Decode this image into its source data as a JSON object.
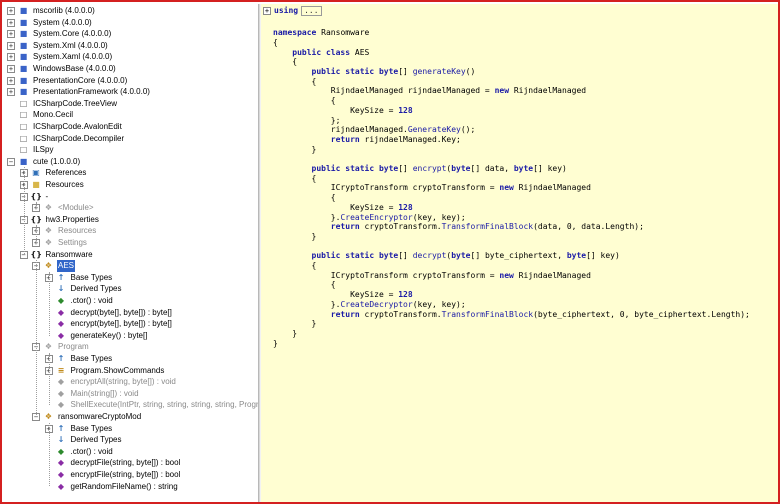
{
  "tree": [
    {
      "depth": 0,
      "exp": "+",
      "icon": "assembly-icon",
      "label": "mscorlib (4.0.0.0)"
    },
    {
      "depth": 0,
      "exp": "+",
      "icon": "assembly-icon",
      "label": "System (4.0.0.0)"
    },
    {
      "depth": 0,
      "exp": "+",
      "icon": "assembly-icon",
      "label": "System.Core (4.0.0.0)"
    },
    {
      "depth": 0,
      "exp": "+",
      "icon": "assembly-icon",
      "label": "System.Xml (4.0.0.0)"
    },
    {
      "depth": 0,
      "exp": "+",
      "icon": "assembly-icon",
      "label": "System.Xaml (4.0.0.0)"
    },
    {
      "depth": 0,
      "exp": "+",
      "icon": "assembly-icon",
      "label": "WindowsBase (4.0.0.0)"
    },
    {
      "depth": 0,
      "exp": "+",
      "icon": "assembly-icon",
      "label": "PresentationCore (4.0.0.0)"
    },
    {
      "depth": 0,
      "exp": "+",
      "icon": "assembly-icon",
      "label": "PresentationFramework (4.0.0.0)"
    },
    {
      "depth": 0,
      "exp": "",
      "icon": "file-icon",
      "label": "ICSharpCode.TreeView"
    },
    {
      "depth": 0,
      "exp": "",
      "icon": "file-icon",
      "label": "Mono.Cecil"
    },
    {
      "depth": 0,
      "exp": "",
      "icon": "file-icon",
      "label": "ICSharpCode.AvalonEdit"
    },
    {
      "depth": 0,
      "exp": "",
      "icon": "file-icon",
      "label": "ICSharpCode.Decompiler"
    },
    {
      "depth": 0,
      "exp": "",
      "icon": "file-icon",
      "label": "ILSpy"
    },
    {
      "depth": 0,
      "exp": "-",
      "icon": "assembly-icon",
      "label": "cute (1.0.0.0)"
    },
    {
      "depth": 1,
      "exp": "+",
      "icon": "references-icon",
      "label": "References"
    },
    {
      "depth": 1,
      "exp": "+",
      "icon": "resources-folder-icon",
      "label": "Resources"
    },
    {
      "depth": 1,
      "exp": "-",
      "icon": "namespace-icon",
      "label": "-"
    },
    {
      "depth": 2,
      "exp": "+",
      "icon": "class-icon",
      "label": "<Module>",
      "dim": true
    },
    {
      "depth": 1,
      "exp": "-",
      "icon": "namespace-icon",
      "label": "hw3.Properties"
    },
    {
      "depth": 2,
      "exp": "+",
      "icon": "class-icon",
      "label": "Resources",
      "dim": true
    },
    {
      "depth": 2,
      "exp": "+",
      "icon": "class-icon",
      "label": "Settings",
      "dim": true
    },
    {
      "depth": 1,
      "exp": "-",
      "icon": "namespace-icon",
      "label": "Ransomware"
    },
    {
      "depth": 2,
      "exp": "-",
      "icon": "class-icon",
      "label": "AES",
      "selected": true
    },
    {
      "depth": 3,
      "exp": "+",
      "icon": "base-types-icon",
      "label": "Base Types"
    },
    {
      "depth": 3,
      "exp": "",
      "icon": "derived-types-icon",
      "label": "Derived Types"
    },
    {
      "depth": 3,
      "exp": "",
      "icon": "constructor-icon",
      "label": ".ctor() : void"
    },
    {
      "depth": 3,
      "exp": "",
      "icon": "method-icon",
      "label": "decrypt(byte[], byte[]) : byte[]"
    },
    {
      "depth": 3,
      "exp": "",
      "icon": "method-icon",
      "label": "encrypt(byte[], byte[]) : byte[]"
    },
    {
      "depth": 3,
      "exp": "",
      "icon": "method-icon",
      "label": "generateKey() : byte[]"
    },
    {
      "depth": 2,
      "exp": "-",
      "icon": "class-icon",
      "label": "Program",
      "dim": true
    },
    {
      "depth": 3,
      "exp": "+",
      "icon": "base-types-icon",
      "label": "Base Types"
    },
    {
      "depth": 3,
      "exp": "+",
      "icon": "enum-icon",
      "label": "Program.ShowCommands"
    },
    {
      "depth": 3,
      "exp": "",
      "icon": "method-icon",
      "label": "encryptAll(string, byte[]) : void",
      "dim": true
    },
    {
      "depth": 3,
      "exp": "",
      "icon": "method-icon",
      "label": "Main(string[]) : void",
      "dim": true
    },
    {
      "depth": 3,
      "exp": "",
      "icon": "method-icon",
      "label": "ShellExecute(IntPtr, string, string, string, string, Progra",
      "dim": true
    },
    {
      "depth": 2,
      "exp": "-",
      "icon": "class-icon",
      "label": "ransomwareCryptoMod"
    },
    {
      "depth": 3,
      "exp": "+",
      "icon": "base-types-icon",
      "label": "Base Types"
    },
    {
      "depth": 3,
      "exp": "",
      "icon": "derived-types-icon",
      "label": "Derived Types"
    },
    {
      "depth": 3,
      "exp": "",
      "icon": "constructor-icon",
      "label": ".ctor() : void"
    },
    {
      "depth": 3,
      "exp": "",
      "icon": "method-icon",
      "label": "decryptFile(string, byte[]) : bool"
    },
    {
      "depth": 3,
      "exp": "",
      "icon": "method-icon",
      "label": "encryptFile(string, byte[]) : bool"
    },
    {
      "depth": 3,
      "exp": "",
      "icon": "method-icon",
      "label": "getRandomFileName() : string"
    }
  ],
  "code": {
    "using_keyword": "using",
    "using_collapsed": "...",
    "lines": [
      [],
      [
        [
          "kw",
          "namespace"
        ],
        [
          "t",
          " Ransomware"
        ]
      ],
      [
        [
          "t",
          "{"
        ]
      ],
      [
        [
          "t",
          "    "
        ],
        [
          "kw",
          "public class"
        ],
        [
          "t",
          " AES"
        ]
      ],
      [
        [
          "t",
          "    {"
        ]
      ],
      [
        [
          "t",
          "        "
        ],
        [
          "kw",
          "public static byte"
        ],
        [
          "t",
          "[] "
        ],
        [
          "fn",
          "generateKey"
        ],
        [
          "t",
          "()"
        ]
      ],
      [
        [
          "t",
          "        {"
        ]
      ],
      [
        [
          "t",
          "            RijndaelManaged rijndaelManaged = "
        ],
        [
          "kw",
          "new"
        ],
        [
          "t",
          " RijndaelManaged"
        ]
      ],
      [
        [
          "t",
          "            {"
        ]
      ],
      [
        [
          "t",
          "                KeySize = "
        ],
        [
          "num",
          "128"
        ]
      ],
      [
        [
          "t",
          "            };"
        ]
      ],
      [
        [
          "t",
          "            rijndaelManaged."
        ],
        [
          "fn",
          "GenerateKey"
        ],
        [
          "t",
          "();"
        ]
      ],
      [
        [
          "t",
          "            "
        ],
        [
          "kw",
          "return"
        ],
        [
          "t",
          " rijndaelManaged.Key;"
        ]
      ],
      [
        [
          "t",
          "        }"
        ]
      ],
      [],
      [
        [
          "t",
          "        "
        ],
        [
          "kw",
          "public static byte"
        ],
        [
          "t",
          "[] "
        ],
        [
          "fn",
          "encrypt"
        ],
        [
          "t",
          "("
        ],
        [
          "kw",
          "byte"
        ],
        [
          "t",
          "[] data, "
        ],
        [
          "kw",
          "byte"
        ],
        [
          "t",
          "[] key)"
        ]
      ],
      [
        [
          "t",
          "        {"
        ]
      ],
      [
        [
          "t",
          "            ICryptoTransform cryptoTransform = "
        ],
        [
          "kw",
          "new"
        ],
        [
          "t",
          " RijndaelManaged"
        ]
      ],
      [
        [
          "t",
          "            {"
        ]
      ],
      [
        [
          "t",
          "                KeySize = "
        ],
        [
          "num",
          "128"
        ]
      ],
      [
        [
          "t",
          "            }."
        ],
        [
          "fn",
          "CreateEncryptor"
        ],
        [
          "t",
          "(key, key);"
        ]
      ],
      [
        [
          "t",
          "            "
        ],
        [
          "kw",
          "return"
        ],
        [
          "t",
          " cryptoTransform."
        ],
        [
          "fn",
          "TransformFinalBlock"
        ],
        [
          "t",
          "(data, 0, data.Length);"
        ]
      ],
      [
        [
          "t",
          "        }"
        ]
      ],
      [],
      [
        [
          "t",
          "        "
        ],
        [
          "kw",
          "public static byte"
        ],
        [
          "t",
          "[] "
        ],
        [
          "fn",
          "decrypt"
        ],
        [
          "t",
          "("
        ],
        [
          "kw",
          "byte"
        ],
        [
          "t",
          "[] byte_ciphertext, "
        ],
        [
          "kw",
          "byte"
        ],
        [
          "t",
          "[] key)"
        ]
      ],
      [
        [
          "t",
          "        {"
        ]
      ],
      [
        [
          "t",
          "            ICryptoTransform cryptoTransform = "
        ],
        [
          "kw",
          "new"
        ],
        [
          "t",
          " RijndaelManaged"
        ]
      ],
      [
        [
          "t",
          "            {"
        ]
      ],
      [
        [
          "t",
          "                KeySize = "
        ],
        [
          "num",
          "128"
        ]
      ],
      [
        [
          "t",
          "            }."
        ],
        [
          "fn",
          "CreateDecryptor"
        ],
        [
          "t",
          "(key, key);"
        ]
      ],
      [
        [
          "t",
          "            "
        ],
        [
          "kw",
          "return"
        ],
        [
          "t",
          " cryptoTransform."
        ],
        [
          "fn",
          "TransformFinalBlock"
        ],
        [
          "t",
          "(byte_ciphertext, 0, byte_ciphertext.Length);"
        ]
      ],
      [
        [
          "t",
          "        }"
        ]
      ],
      [
        [
          "t",
          "    }"
        ]
      ],
      [
        [
          "t",
          "}"
        ]
      ]
    ]
  },
  "colors": {
    "frame_border": "#d42020",
    "code_background": "#fffed2",
    "selection": "#3166c9",
    "keyword": "#1a1aa6"
  }
}
